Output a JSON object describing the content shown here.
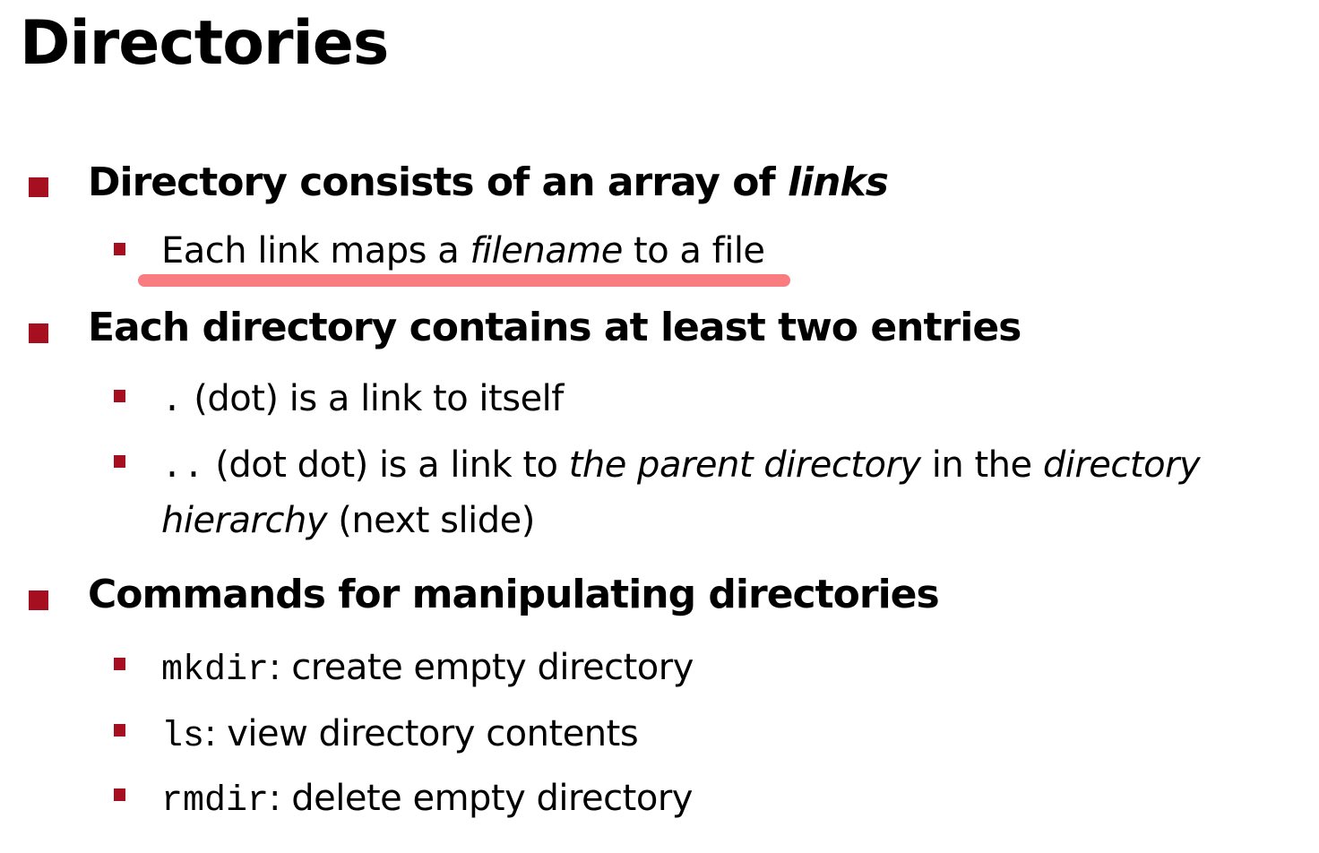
{
  "slide": {
    "title": "Directories",
    "accent_color": "#a50f20",
    "highlight_color": "#f87c80"
  },
  "b1": {
    "text": "Directory consists of an array of ",
    "italic": "links",
    "sub1": {
      "text_a": "Each link maps a ",
      "italic": "filename",
      "text_b": " to a file"
    }
  },
  "b2": {
    "text": "Each directory contains at least two entries",
    "sub1": {
      "code": ".",
      "text": " (dot) is  a link to itself"
    },
    "sub2": {
      "code": "..",
      "text_a": " (dot dot) is a link to ",
      "italic_a": "the parent directory",
      "text_b": " in the ",
      "italic_b": "directory",
      "italic_c": "hierarchy",
      "text_c": " (next slide)"
    }
  },
  "b3": {
    "text": "Commands for manipulating directories",
    "items": [
      {
        "code": "mkdir",
        "text": ": create empty directory"
      },
      {
        "code": "ls",
        "text": ": view directory contents"
      },
      {
        "code": "rmdir",
        "text": ": delete empty directory"
      }
    ]
  }
}
